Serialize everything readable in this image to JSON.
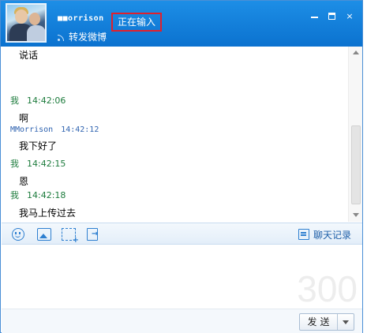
{
  "header": {
    "contact_name": "■■orrison",
    "typing_status": "正在输入",
    "share_label": "转发微博"
  },
  "window_controls": {
    "minimize": "minimize",
    "maximize": "maximize",
    "close": "×"
  },
  "messages": [
    {
      "sender": "",
      "time": "",
      "text": "说话"
    },
    {
      "sender": "我",
      "time": "14:42:06",
      "text": "啊"
    },
    {
      "sender": "MMorrison",
      "time": "14:42:12",
      "text": "我下好了"
    },
    {
      "sender": "我",
      "time": "14:42:15",
      "text": "恩"
    },
    {
      "sender": "我",
      "time": "14:42:18",
      "text": "我马上传过去"
    }
  ],
  "toolbar": {
    "history_label": "聊天记录"
  },
  "input": {
    "char_count": "300"
  },
  "actions": {
    "send_label": "发送"
  }
}
